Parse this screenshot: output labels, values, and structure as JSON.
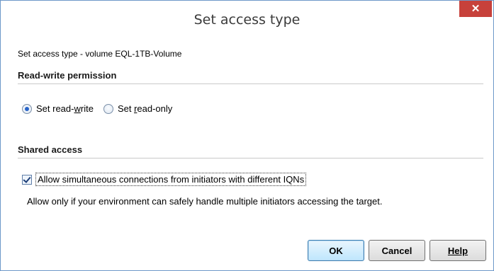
{
  "window": {
    "title": "Set access type",
    "close_glyph": "✕"
  },
  "subtitle": "Set access type - volume EQL-1TB-Volume",
  "read_write": {
    "header": "Read-write permission",
    "options": [
      {
        "label": "Set read-write",
        "checked": true
      },
      {
        "label": "Set read-only",
        "checked": false
      }
    ]
  },
  "shared": {
    "header": "Shared access",
    "checkbox_label": "Allow simultaneous connections from initiators with different IQNs",
    "checkbox_checked": true,
    "note": "Allow only if your environment can safely handle multiple initiators accessing the target."
  },
  "buttons": {
    "ok": "OK",
    "cancel": "Cancel",
    "help": "Help"
  },
  "colors": {
    "close_bg": "#c7413b",
    "accent": "#2864c8",
    "border": "#6d98c9"
  }
}
